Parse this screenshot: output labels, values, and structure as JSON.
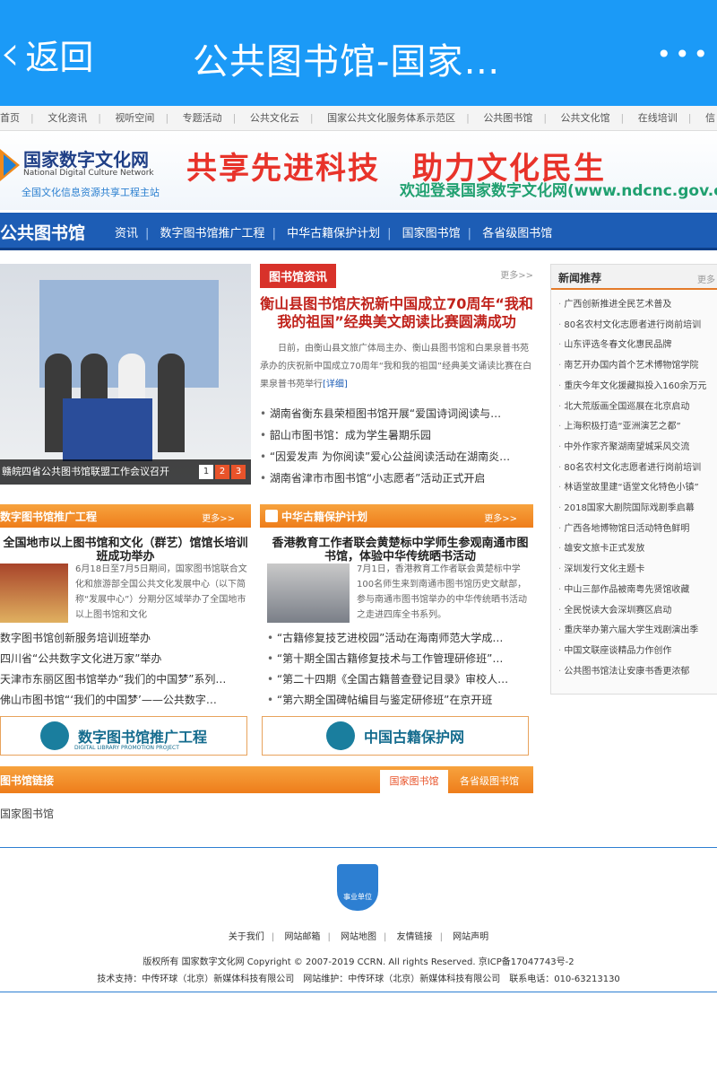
{
  "appbar": {
    "back_label": "返回",
    "title": "公共图书馆-国家…",
    "more_icon": "more-dots-icon"
  },
  "topnav": [
    "首页",
    "文化资讯",
    "视听空间",
    "专题活动",
    "公共文化云",
    "国家公共文化服务体系示范区",
    "公共图书馆",
    "公共文化馆",
    "在线培训",
    "信"
  ],
  "banner": {
    "logo_cn": "国家数字文化网",
    "logo_en": "National Digital Culture Network",
    "logo_sub": "全国文化信息资源共享工程主站",
    "slogan": "共享先进科技　助力文化民生",
    "welcome": "欢迎登录国家数字文化网(www.ndcnc.gov.cn)"
  },
  "colnav": {
    "name": "公共图书馆",
    "links": [
      "资讯",
      "数字图书馆推广工程",
      "中华古籍保护计划",
      "国家图书馆",
      "各省级图书馆"
    ]
  },
  "slider": {
    "caption": "赣皖四省公共图书馆联盟工作会议召开",
    "pages": [
      "1",
      "2",
      "3"
    ]
  },
  "library_news": {
    "tag": "图书馆资讯",
    "more": "更多>>",
    "headline": "衡山县图书馆庆祝新中国成立70周年“我和我的祖国”经典美文朗读比赛圆满成功",
    "summary": "日前，由衡山县文旅广体局主办、衡山县图书馆和白果泉普书苑承办的庆祝新中国成立70周年“我和我的祖国”经典美文诵读比赛在白果泉普书苑举行",
    "detail": "[详细]",
    "items": [
      "湖南省衡东县荣桓图书馆开展“爱国诗词阅读与…",
      "韶山市图书馆：成为学生暑期乐园",
      "“因爱发声 为你阅读”爱心公益阅读活动在湖南炎…",
      "湖南省津市市图书馆“小志愿者”活动正式开启"
    ]
  },
  "sidebar": {
    "title": "新闻推荐",
    "more": "更多",
    "items": [
      "广西创新推进全民艺术普及",
      "80名农村文化志愿者进行岗前培训",
      "山东评选冬春文化惠民品牌",
      "南艺开办国内首个艺术博物馆学院",
      "重庆今年文化援藏拟投入160余万元",
      "北大荒版画全国巡展在北京启动",
      "上海积极打造“亚洲演艺之都”",
      "中外作家齐聚湖南望城采风交流",
      "80名农村文化志愿者进行岗前培训",
      "林语堂故里建“语堂文化特色小镇”",
      "2018国家大剧院国际戏剧季启幕",
      "广西各地博物馆日活动特色鲜明",
      "雄安文旅卡正式发放",
      "深圳发行文化主题卡",
      "中山三部作品被南粤先贤馆收藏",
      "全民悦读大会深圳赛区启动",
      "重庆举办第六届大学生戏剧演出季",
      "中国文联座谈精品力作创作",
      "公共图书馆法让安康书香更浓郁"
    ]
  },
  "digital_library": {
    "title": "数字图书馆推广工程",
    "more": "更多>>",
    "headline": "全国地市以上图书馆和文化（群艺）馆馆长培训班成功举办",
    "summary": "6月18日至7月5日期间，国家图书馆联合文化和旅游部全国公共文化发展中心（以下简称“发展中心”）分期分区域举办了全国地市以上图书馆和文化",
    "items": [
      "数字图书馆创新服务培训班举办",
      "四川省“公共数字文化进万家”举办",
      "天津市东丽区图书馆举办“我们的中国梦”系列…",
      "佛山市图书馆“‘我们的中国梦’——公共数字…"
    ]
  },
  "ancient_books": {
    "title": "中华古籍保护计划",
    "more": "更多>>",
    "headline": "香港教育工作者联会黄楚标中学师生参观南通市图书馆，体验中华传统晒书活动",
    "summary": "7月1日，香港教育工作者联会黄楚标中学100名师生来到南通市图书馆历史文献部，参与南通市图书馆举办的中华传统晒书活动之走进四库全书系列。",
    "items": [
      "“古籍修复技艺进校园”活动在海南师范大学成…",
      "“第十期全国古籍修复技术与工作管理研修班”…",
      "“第二十四期《全国古籍普查登记目录》审校人…",
      "“第六期全国碑帖编目与鉴定研修班”在京开班"
    ]
  },
  "promos": {
    "left": "数字图书馆推广工程",
    "left_sub": "DIGITAL LIBRARY PROMOTION PROJECT",
    "right": "中国古籍保护网"
  },
  "links_section": {
    "title": "图书馆链接",
    "tab_active": "国家图书馆",
    "tab_other": "各省级图书馆",
    "item": "国家图书馆"
  },
  "footer": {
    "badge": "事业单位",
    "links": [
      "关于我们",
      "网站邮箱",
      "网站地图",
      "友情链接",
      "网站声明"
    ],
    "copyright": "版权所有 国家数字文化网 Copyright © 2007-2019 CCRN. All rights Reserved. 京ICP备17047743号-2",
    "tech": "技术支持：中传环球（北京）新媒体科技有限公司　网站维护：中传环球（北京）新媒体科技有限公司　联系电话：010-63213130"
  },
  "colors": {
    "appbar": "#1b9af7",
    "nav_blue": "#1d5db5",
    "orange": "#ee7d1b",
    "red": "#d8322a"
  }
}
